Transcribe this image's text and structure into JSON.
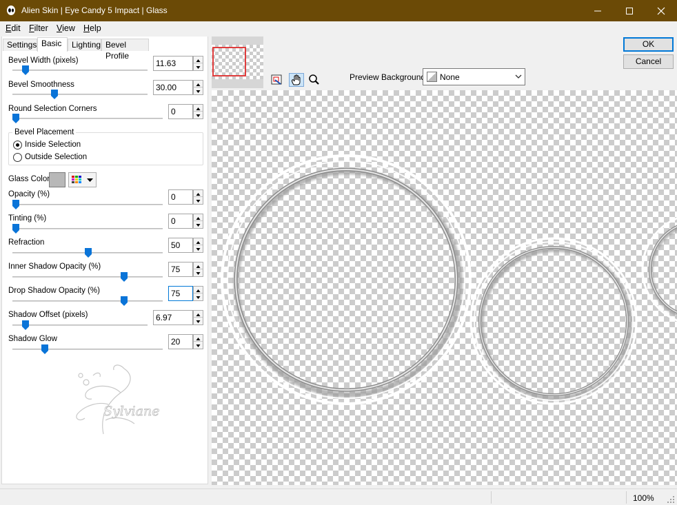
{
  "window": {
    "title": "Alien Skin | Eye Candy 5 Impact | Glass"
  },
  "menu": [
    "Edit",
    "Filter",
    "View",
    "Help"
  ],
  "tabs": [
    "Settings",
    "Basic",
    "Lighting",
    "Bevel Profile"
  ],
  "active_tab": "Basic",
  "params": {
    "bevel_width": {
      "label": "Bevel Width (pixels)",
      "value": "11.63"
    },
    "bevel_smoothness": {
      "label": "Bevel Smoothness",
      "value": "30.00"
    },
    "round_corners": {
      "label": "Round Selection Corners",
      "value": "0"
    },
    "bevel_placement": {
      "label": "Bevel Placement",
      "options": [
        "Inside Selection",
        "Outside Selection"
      ],
      "selected": "Inside Selection"
    },
    "glass_color": {
      "label": "Glass Color",
      "color": "#b8b8b8"
    },
    "opacity": {
      "label": "Opacity (%)",
      "value": "0"
    },
    "tinting": {
      "label": "Tinting (%)",
      "value": "0"
    },
    "refraction": {
      "label": "Refraction",
      "value": "50"
    },
    "inner_shadow_opacity": {
      "label": "Inner Shadow Opacity (%)",
      "value": "75"
    },
    "drop_shadow_opacity": {
      "label": "Drop Shadow Opacity (%)",
      "value": "75"
    },
    "shadow_offset": {
      "label": "Shadow Offset (pixels)",
      "value": "6.97"
    },
    "shadow_glow": {
      "label": "Shadow Glow",
      "value": "20"
    }
  },
  "watermark": {
    "text": "Sylviane"
  },
  "tools": [
    "navigate-icon",
    "hand-icon",
    "zoom-icon"
  ],
  "preview_background": {
    "label": "Preview Background:",
    "value": "None"
  },
  "buttons": {
    "ok": "OK",
    "cancel": "Cancel"
  },
  "status": {
    "zoom": "100%"
  },
  "colors": {
    "titlebar": "#6b4a06",
    "accent": "#0078d7",
    "nav_frame": "#e03c3c"
  }
}
